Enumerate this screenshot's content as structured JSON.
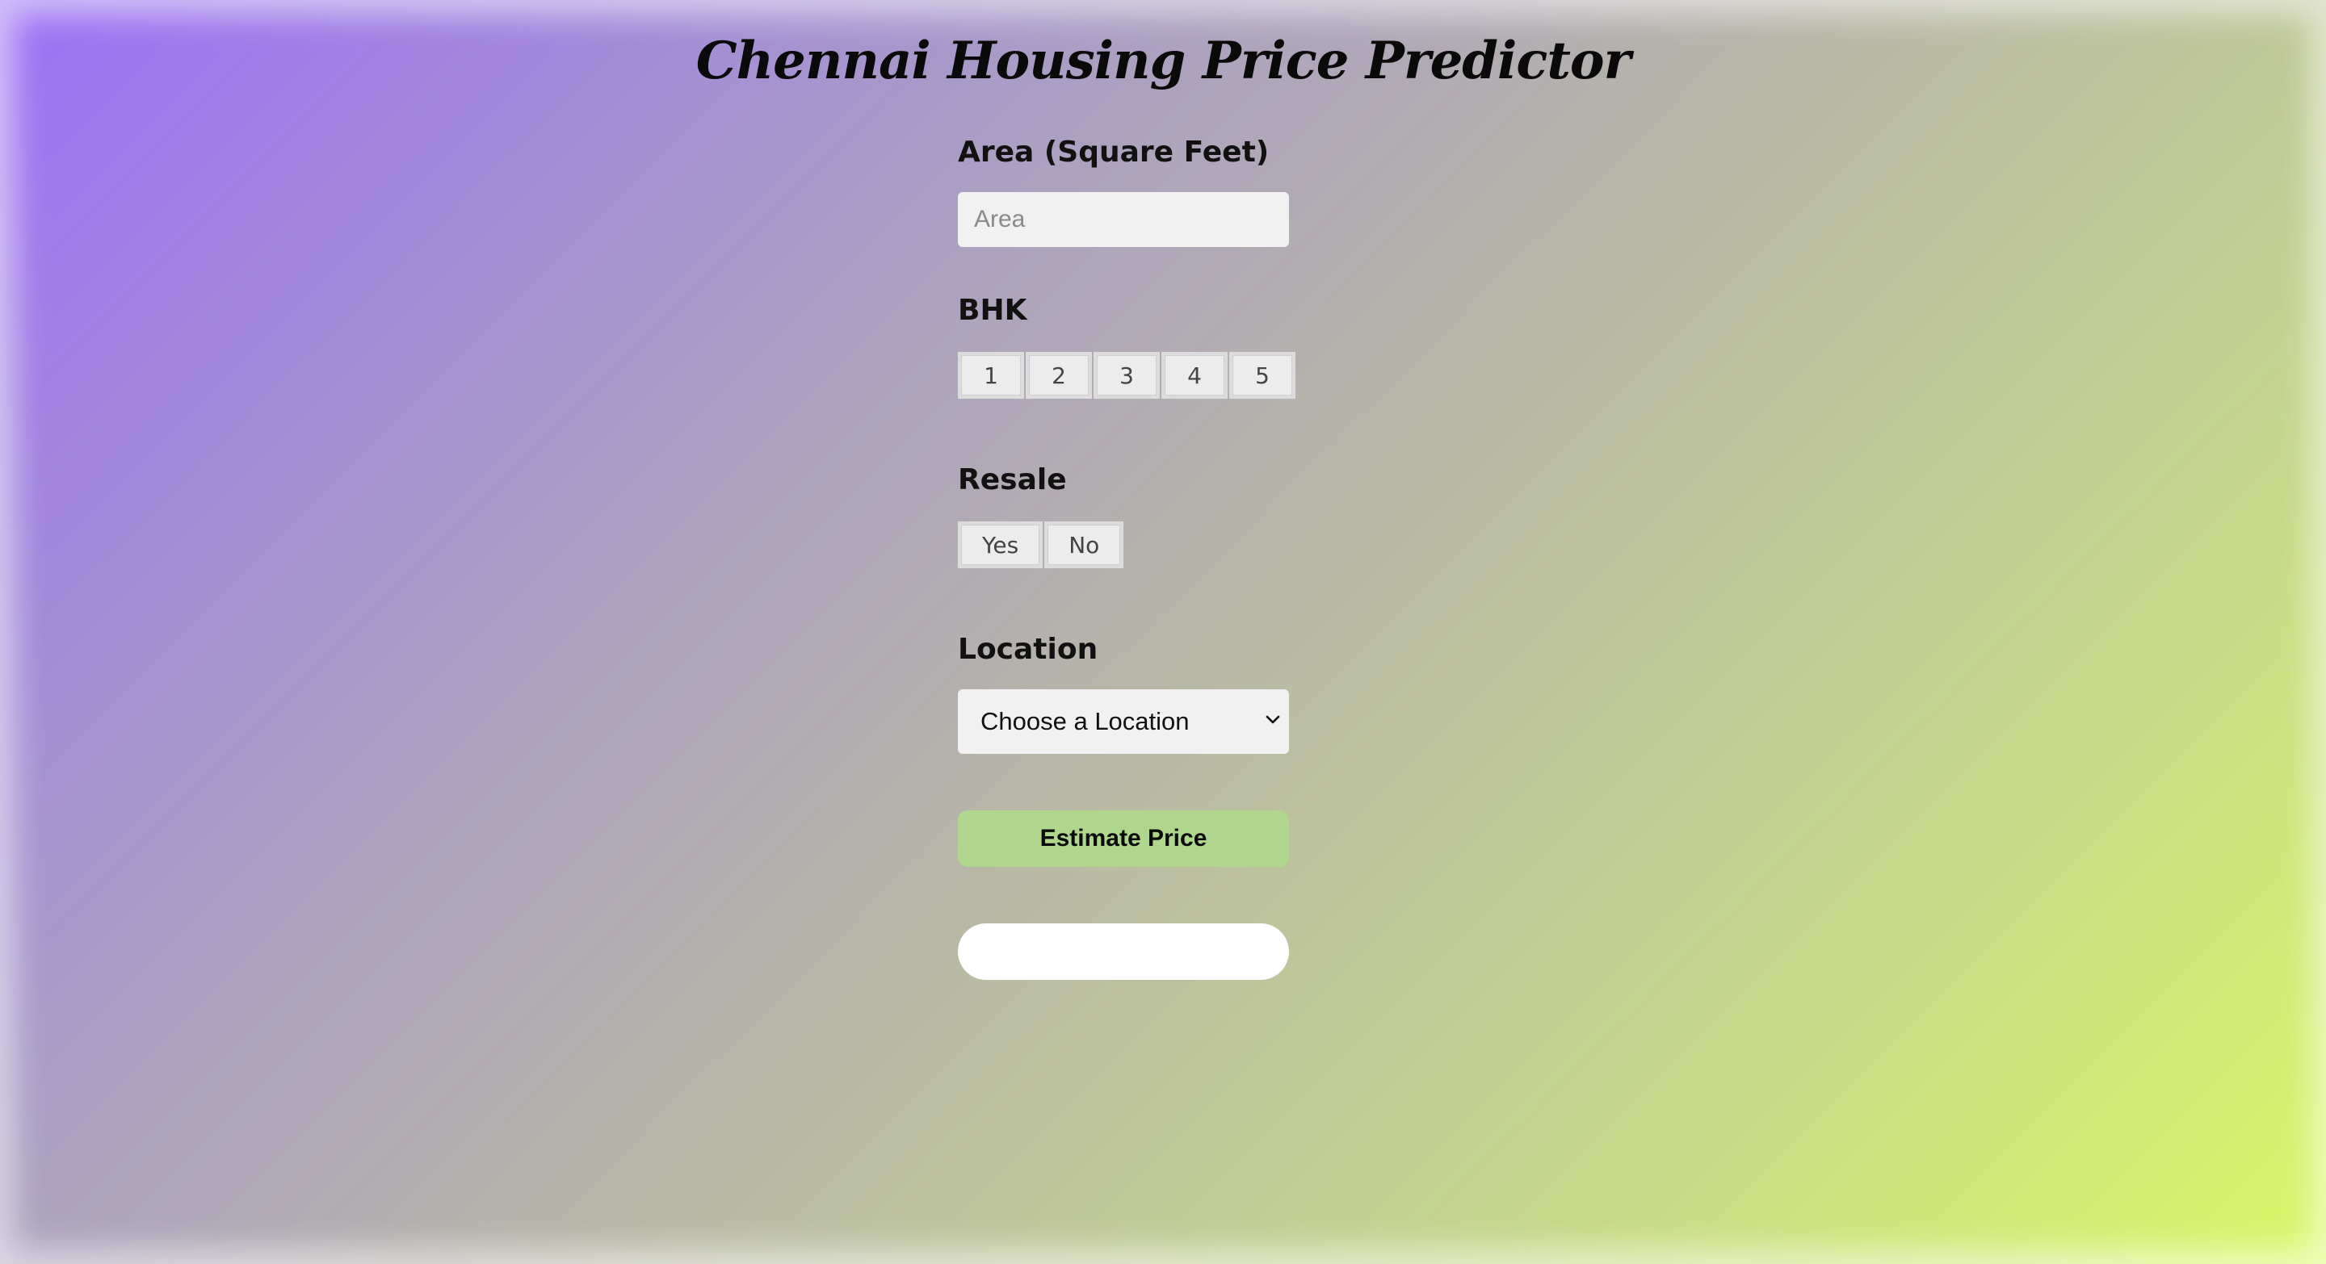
{
  "page": {
    "title": "Chennai Housing Price Predictor"
  },
  "form": {
    "area": {
      "label": "Area (Square Feet)",
      "value": "",
      "placeholder": "Area"
    },
    "bhk": {
      "label": "BHK",
      "options": [
        "1",
        "2",
        "3",
        "4",
        "5"
      ]
    },
    "resale": {
      "label": "Resale",
      "options": [
        "Yes",
        "No"
      ]
    },
    "location": {
      "label": "Location",
      "selected": "Choose a Location",
      "icon": "chevron-down-icon"
    },
    "estimate_button": "Estimate Price",
    "result_text": ""
  }
}
